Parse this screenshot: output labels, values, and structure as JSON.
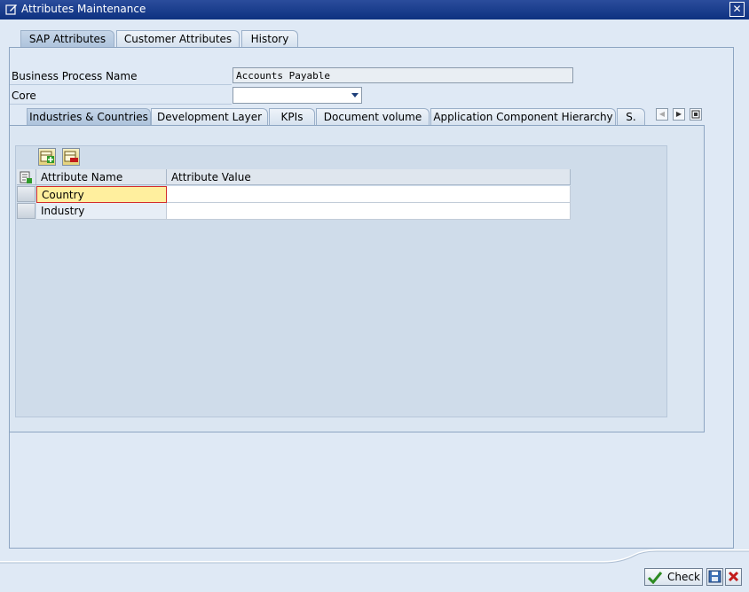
{
  "window": {
    "title": "Attributes Maintenance"
  },
  "top_tabs": [
    {
      "label": "SAP Attributes"
    },
    {
      "label": "Customer Attributes"
    },
    {
      "label": "History"
    }
  ],
  "form": {
    "business_process_label": "Business Process Name",
    "business_process_value": "Accounts Payable",
    "core_label": "Core",
    "core_value": ""
  },
  "sub_tabs": [
    {
      "label": "Industries & Countries"
    },
    {
      "label": "Development Layer"
    },
    {
      "label": "KPIs"
    },
    {
      "label": "Document volume"
    },
    {
      "label": "Application Component Hierarchy"
    },
    {
      "label": "S."
    }
  ],
  "table": {
    "columns": [
      "Attribute Name",
      "Attribute Value"
    ],
    "rows": [
      {
        "name": "Country",
        "value": ""
      },
      {
        "name": "Industry",
        "value": ""
      }
    ]
  },
  "footer": {
    "check_label": "Check"
  },
  "colors": {
    "title_bar": "#1c3d8c",
    "focus_cell": "#ffef9e",
    "check_icon": "#2e8b22",
    "cancel_icon": "#c21b1b"
  }
}
